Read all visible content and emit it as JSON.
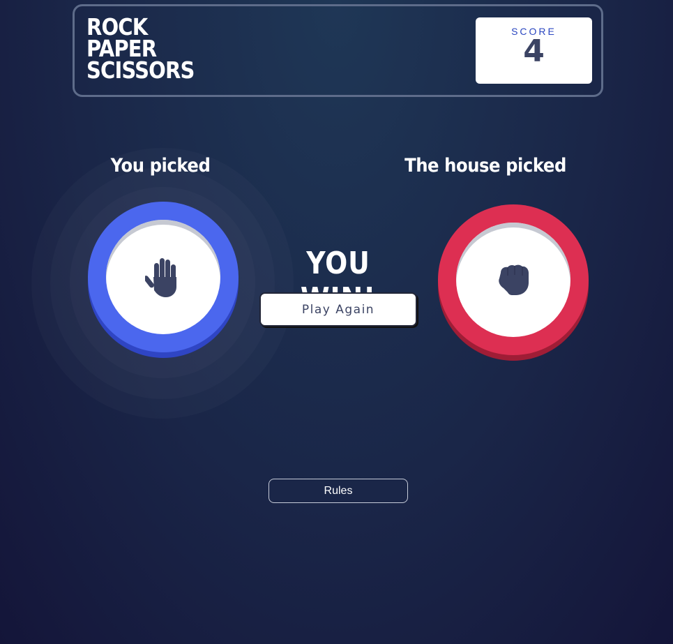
{
  "header": {
    "title_lines": [
      "ROCK",
      "PAPER",
      "SCISSORS"
    ],
    "score_label": "SCORE",
    "score_value": "4"
  },
  "game": {
    "you_label": "You picked",
    "house_label": "The house picked",
    "you_pick": "paper",
    "house_pick": "rock",
    "you_pick_icon": "hand-paper-icon",
    "house_pick_icon": "hand-rock-icon",
    "result_text": "YOU WIN!",
    "play_again_label": "Play Again"
  },
  "footer": {
    "rules_label": "Rules"
  },
  "colors": {
    "paper": "#4b67ee",
    "rock": "#dd2f52",
    "background": "#1a2648",
    "icon": "#3b4363"
  }
}
